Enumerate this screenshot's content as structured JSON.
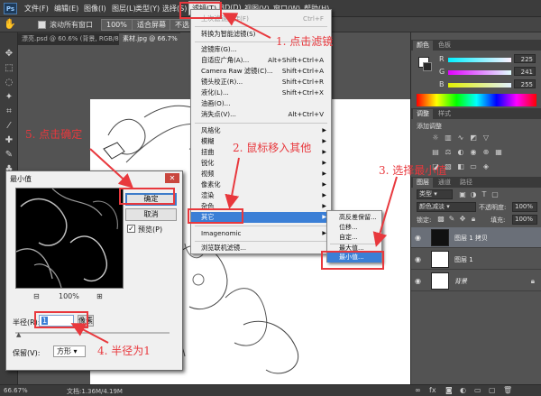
{
  "menubar": {
    "logo": "Ps",
    "items": [
      "文件(F)",
      "编辑(E)",
      "图像(I)",
      "图层(L)",
      "类型(Y)",
      "选择(S)",
      "滤镜(T)",
      "3D(D)",
      "视图(V)",
      "窗口(W)",
      "帮助(H)"
    ]
  },
  "optionsbar": {
    "scroll_all_label": "滚动所有窗口",
    "zoom_button": "100%",
    "fit_button": "适合屏幕",
    "fill_button_partial": "不选"
  },
  "tabs": [
    "漂亮.psd @ 60.6% (背景, RGB/8#)",
    "素材.jpg @ 66.7%"
  ],
  "filter_menu": {
    "items": [
      {
        "text": "上次滤镜操作(F)",
        "key": "Ctrl+F",
        "disabled": true
      },
      {
        "sep": true
      },
      {
        "text": "转换为智能滤镜(S)"
      },
      {
        "sep": true
      },
      {
        "text": "滤镜库(G)..."
      },
      {
        "text": "自适应广角(A)...",
        "key": "Alt+Shift+Ctrl+A"
      },
      {
        "text": "Camera Raw 滤镜(C)...",
        "key": "Shift+Ctrl+A"
      },
      {
        "text": "镜头校正(R)...",
        "key": "Shift+Ctrl+R"
      },
      {
        "text": "液化(L)...",
        "key": "Shift+Ctrl+X"
      },
      {
        "text": "油画(O)..."
      },
      {
        "text": "消失点(V)...",
        "key": "Alt+Ctrl+V"
      },
      {
        "sep": true
      },
      {
        "text": "风格化",
        "arrow": true
      },
      {
        "text": "模糊",
        "arrow": true
      },
      {
        "text": "扭曲",
        "arrow": true
      },
      {
        "text": "锐化",
        "arrow": true
      },
      {
        "text": "视频",
        "arrow": true
      },
      {
        "text": "像素化",
        "arrow": true
      },
      {
        "text": "渲染",
        "arrow": true
      },
      {
        "text": "杂色",
        "arrow": true
      },
      {
        "text": "其它",
        "arrow": true,
        "highlight": true
      },
      {
        "sep": true
      },
      {
        "text": "Imagenomic",
        "arrow": true
      },
      {
        "sep": true
      },
      {
        "text": "浏览联机滤镜..."
      }
    ]
  },
  "other_submenu": {
    "items": [
      {
        "text": "高反差保留..."
      },
      {
        "text": "位移..."
      },
      {
        "text": "自定..."
      },
      {
        "sep": true
      },
      {
        "text": "最大值..."
      },
      {
        "text": "最小值...",
        "highlight": true
      }
    ]
  },
  "color_panel": {
    "tabs": [
      "颜色",
      "色板"
    ],
    "r_label": "R",
    "g_label": "G",
    "b_label": "B",
    "r_value": "225",
    "g_value": "241",
    "b_value": "255"
  },
  "adjust_panel": {
    "tabs": [
      "调整",
      "样式"
    ],
    "title": "添加调整"
  },
  "layers_panel": {
    "tabs": [
      "图层",
      "通道",
      "路径"
    ],
    "kind_label": "类型",
    "blend_mode": "颜色减淡",
    "opacity_label": "不透明度:",
    "opacity_value": "100%",
    "lock_label": "锁定:",
    "fill_label": "填充:",
    "fill_value": "100%",
    "layers": [
      {
        "name": "图层 1 拷贝",
        "selected": true,
        "dark": true
      },
      {
        "name": "图层 1",
        "selected": false,
        "dark": false
      },
      {
        "name": "背景",
        "selected": false,
        "dark": false,
        "italic": true,
        "locked": true
      }
    ]
  },
  "dialog": {
    "title": "最小值",
    "ok_label": "确定",
    "cancel_label": "取消",
    "preview_label": "预览(P)",
    "preview_checked": "✓",
    "zoom_out": "⊟",
    "zoom_value": "100%",
    "zoom_in": "⊞",
    "radius_label": "半径(R):",
    "radius_value": "1",
    "radius_unit": "像素",
    "keep_label": "保留(V):",
    "keep_value": "方形"
  },
  "statusbar": {
    "zoom": "66.67%",
    "doc_info": "文档:1.36M/4.19M"
  },
  "annotations": [
    "1. 点击滤镜",
    "2. 鼠标移入其他",
    "3. 选择最小值",
    "4. 半径为1",
    "5. 点击确定"
  ],
  "colors": {
    "accent": "#e8383d",
    "menu_highlight": "#3b7fd6",
    "ui_dark": "#535353"
  }
}
